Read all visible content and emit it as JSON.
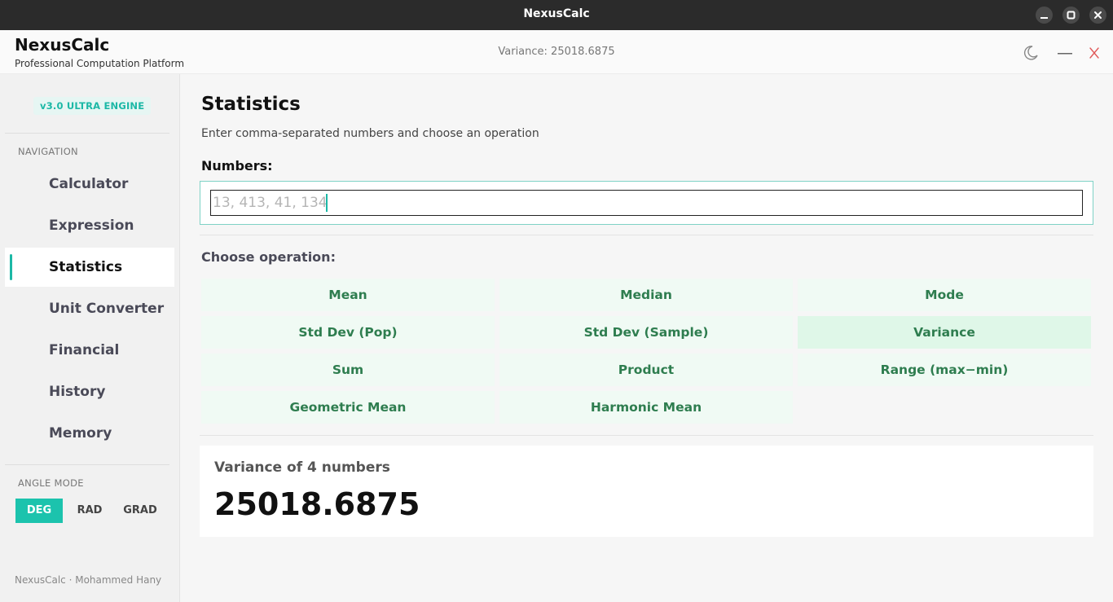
{
  "window": {
    "title": "NexusCalc"
  },
  "header": {
    "brand": "NexusCalc",
    "subtitle": "Professional Computation Platform",
    "status": "Variance: 25018.6875"
  },
  "sidebar": {
    "badge": "v3.0  ULTRA ENGINE",
    "nav_label": "NAVIGATION",
    "items": [
      {
        "label": "Calculator"
      },
      {
        "label": "Expression"
      },
      {
        "label": "Statistics"
      },
      {
        "label": "Unit Converter"
      },
      {
        "label": "Financial"
      },
      {
        "label": "History"
      },
      {
        "label": "Memory"
      }
    ],
    "angle_label": "ANGLE MODE",
    "angle_modes": [
      {
        "label": "DEG"
      },
      {
        "label": "RAD"
      },
      {
        "label": "GRAD"
      }
    ],
    "angle_selected": "DEG",
    "footer": "NexusCalc · Mohammed Hany"
  },
  "main": {
    "title": "Statistics",
    "description": "Enter comma-separated numbers and choose an operation",
    "numbers_label": "Numbers:",
    "numbers_placeholder": "13, 413, 41, 134",
    "numbers_value": "",
    "choose_label": "Choose operation:",
    "operations": [
      {
        "label": "Mean"
      },
      {
        "label": "Median"
      },
      {
        "label": "Mode"
      },
      {
        "label": "Std Dev (Pop)"
      },
      {
        "label": "Std Dev (Sample)"
      },
      {
        "label": "Variance"
      },
      {
        "label": "Sum"
      },
      {
        "label": "Product"
      },
      {
        "label": "Range (max−min)"
      },
      {
        "label": "Geometric Mean"
      },
      {
        "label": "Harmonic Mean"
      }
    ],
    "selected_operation": "Variance",
    "result": {
      "label": "Variance of 4 numbers",
      "value": "25018.6875"
    }
  },
  "colors": {
    "accent": "#1cb8a6",
    "op_text": "#2e7d4f",
    "op_bg": "#f0faf4",
    "titlebar": "#2b2b2b"
  }
}
